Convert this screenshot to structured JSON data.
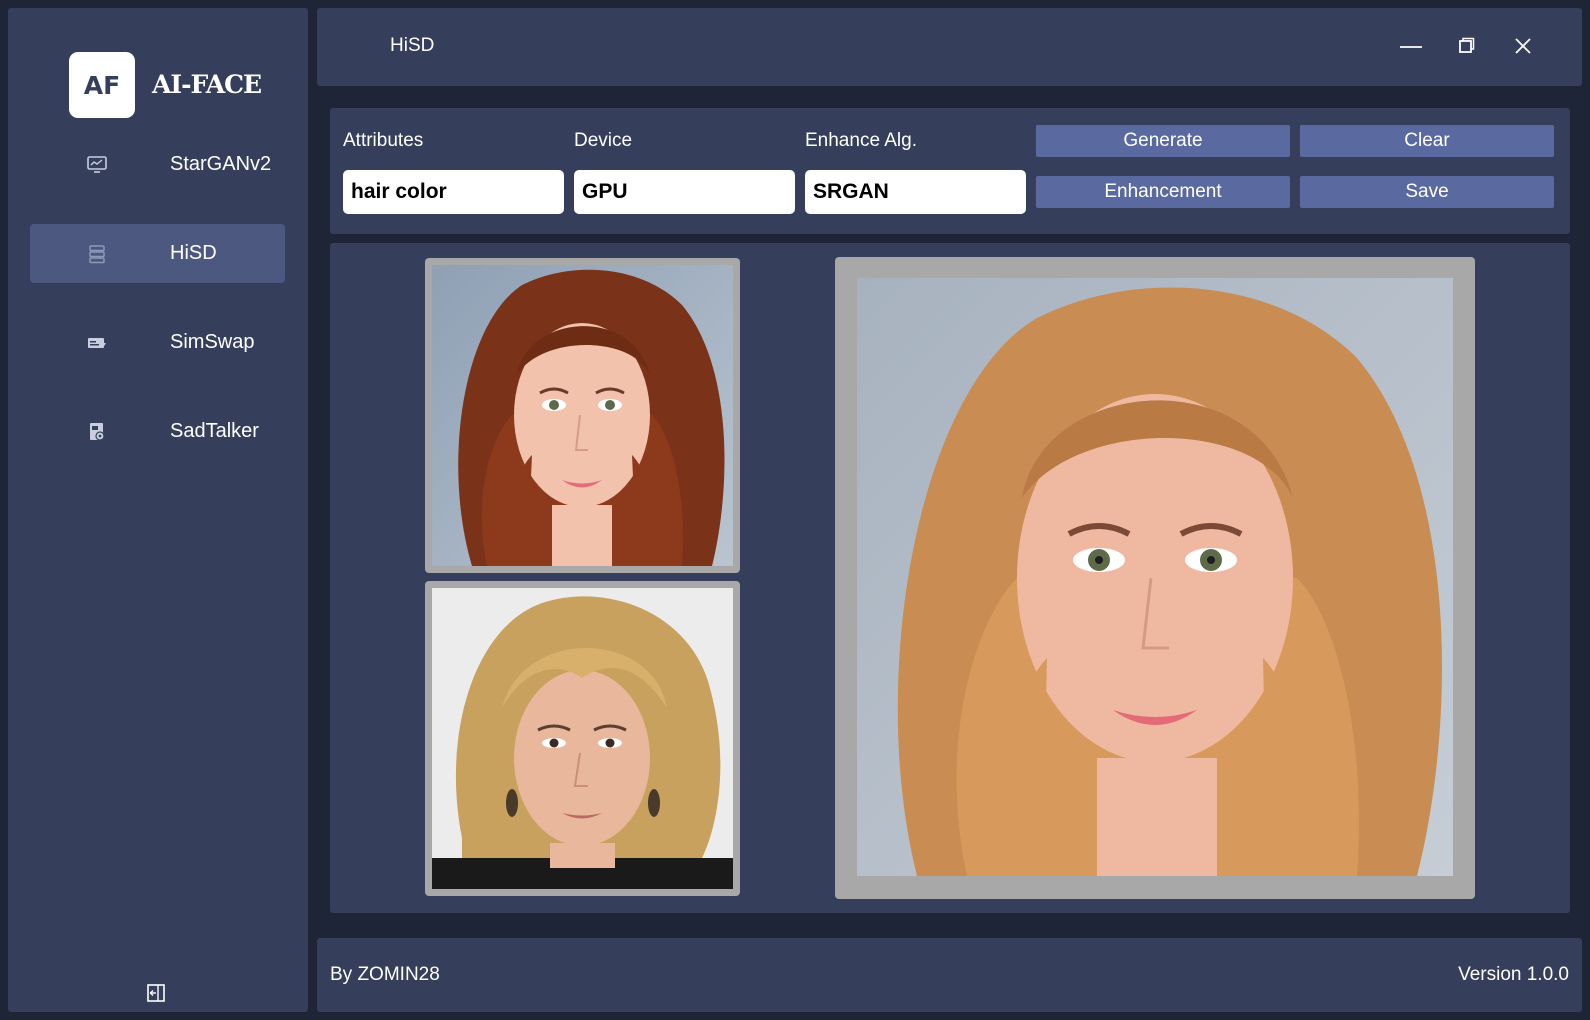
{
  "app": {
    "logo_mark": "AF",
    "logo_text": "AI-FACE"
  },
  "sidebar": {
    "items": [
      {
        "label": "StarGANv2",
        "icon": "monitor-chart-icon",
        "active": false
      },
      {
        "label": "HiSD",
        "icon": "server-stack-icon",
        "active": true
      },
      {
        "label": "SimSwap",
        "icon": "card-swap-icon",
        "active": false
      },
      {
        "label": "SadTalker",
        "icon": "media-file-icon",
        "active": false
      }
    ],
    "collapse_icon": "collapse-left-icon"
  },
  "titlebar": {
    "title": "HiSD",
    "minimize_icon": "minimize-icon",
    "maximize_icon": "restore-icon",
    "close_icon": "close-icon"
  },
  "controls": {
    "attributes_label": "Attributes",
    "attributes_value": "hair color",
    "device_label": "Device",
    "device_value": "GPU",
    "enhance_label": "Enhance Alg.",
    "enhance_value": "SRGAN",
    "generate_label": "Generate",
    "clear_label": "Clear",
    "enhancement_label": "Enhancement",
    "save_label": "Save"
  },
  "images": {
    "source_image": "source-face-photo",
    "reference_image": "reference-face-photo",
    "result_image": "result-face-photo"
  },
  "footer": {
    "author": "By ZOMIN28",
    "version": "Version 1.0.0"
  },
  "colors": {
    "background": "#1e2537",
    "panel": "#353f5b",
    "active_nav": "#4c5880",
    "button": "#5a69a0",
    "image_frame": "#a8a8a8"
  }
}
